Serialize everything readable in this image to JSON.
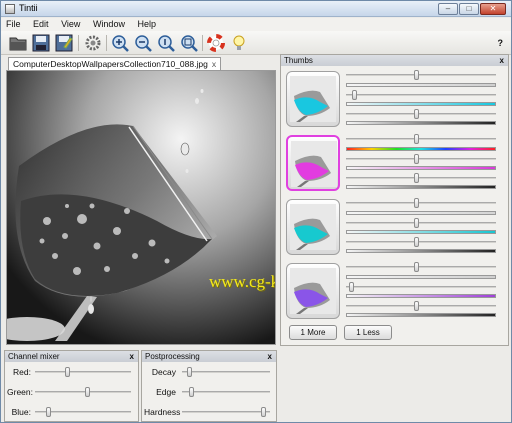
{
  "window": {
    "title": "Tintii"
  },
  "menu": [
    "File",
    "Edit",
    "View",
    "Window",
    "Help"
  ],
  "toolbar": {
    "icons": [
      "open-folder-icon",
      "save-icon",
      "save-as-icon",
      "settings-gear-icon",
      "zoom-in-icon",
      "zoom-out-icon",
      "zoom-actual-icon",
      "zoom-fit-icon",
      "help-lifebuoy-icon",
      "tip-lightbulb-icon"
    ],
    "help_label": "?"
  },
  "image_tab": {
    "filename": "ComputerDesktopWallpapersCollection710_088.jpg",
    "close_label": "x"
  },
  "watermark": "www.cg-ku.com",
  "thumbs": {
    "title": "Thumbs",
    "close_label": "x",
    "rows": [
      {
        "hue_color": "#19c7e0",
        "selected": false,
        "hue_range": [
          0.0,
          0.0
        ],
        "gradients": [
          "#cfcfcf",
          "#18c8e0"
        ],
        "slider_levels": [
          0.47,
          0.04,
          0.47
        ]
      },
      {
        "hue_color": "#e23ce0",
        "selected": true,
        "hue_range": [
          0.0,
          0.0
        ],
        "gradients": [
          "rainbow",
          "#d83ad8"
        ],
        "slider_levels": [
          0.47,
          0.47,
          0.47
        ]
      },
      {
        "hue_color": "#17c9cf",
        "selected": false,
        "hue_range": [
          0.0,
          0.0
        ],
        "gradients": [
          "#d5d5d5",
          "#17c5d0"
        ],
        "slider_levels": [
          0.47,
          0.47,
          0.47
        ]
      },
      {
        "hue_color": "#8a55e8",
        "selected": false,
        "hue_range": [
          0.0,
          0.0
        ],
        "gradients": [
          "#cfcfcf",
          "#a040d8"
        ],
        "slider_levels": [
          0.47,
          0.02,
          0.47
        ]
      }
    ],
    "more_button": "1 More",
    "less_button": "1 Less"
  },
  "channel_mixer": {
    "title": "Channel mixer",
    "close_label": "x",
    "rows": [
      {
        "label": "Red:",
        "level": 0.33
      },
      {
        "label": "Green:",
        "level": 0.55
      },
      {
        "label": "Blue:",
        "level": 0.12
      }
    ]
  },
  "postprocessing": {
    "title": "Postprocessing",
    "close_label": "x",
    "rows": [
      {
        "label": "Decay",
        "level": 0.06
      },
      {
        "label": "Edge",
        "level": 0.09
      },
      {
        "label": "Hardness",
        "level": 0.95
      }
    ]
  }
}
